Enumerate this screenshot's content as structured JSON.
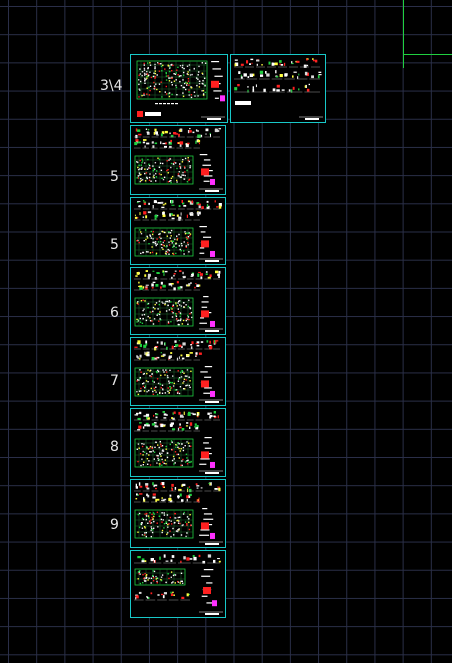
{
  "viewport": {
    "background": "#000000",
    "grid_color": "#2a2f48",
    "sheet_border_color": "#18c8c8",
    "accent_green": "#20d040",
    "accent_red": "#ff2020",
    "accent_magenta": "#ff30ff"
  },
  "sheet_labels": {
    "row1": "3\\4",
    "row2": "5",
    "row3": "5",
    "row4": "6",
    "row5": "7",
    "row6": "8",
    "row7": "9"
  }
}
